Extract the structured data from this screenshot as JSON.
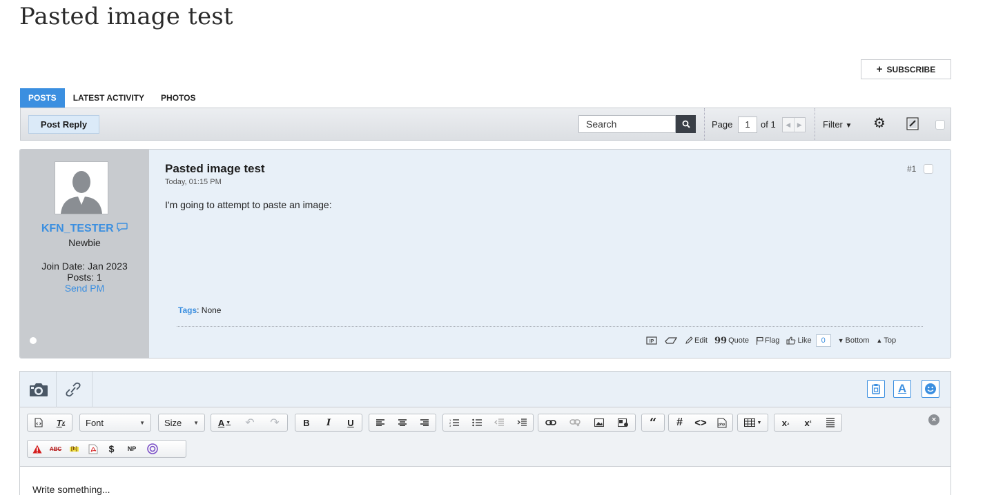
{
  "page": {
    "title": "Pasted image test"
  },
  "subscribe": {
    "label": "SUBSCRIBE"
  },
  "tabs": [
    {
      "label": "POSTS",
      "active": true
    },
    {
      "label": "LATEST ACTIVITY",
      "active": false
    },
    {
      "label": "PHOTOS",
      "active": false
    }
  ],
  "toolbar": {
    "post_reply": "Post Reply",
    "search_placeholder": "Search",
    "page_label": "Page",
    "page_value": "1",
    "of_label": "of 1",
    "filter_label": "Filter"
  },
  "post": {
    "author": {
      "username": "KFN_TESTER",
      "title": "Newbie",
      "join_date": "Join Date: Jan 2023",
      "posts": "Posts: 1",
      "send_pm": "Send PM"
    },
    "title": "Pasted image test",
    "date": "Today, 01:15 PM",
    "number": "#1",
    "body": "I'm going to attempt to paste an image:",
    "tags_label": "Tags",
    "tags_value": ": None",
    "actions": {
      "edit": "Edit",
      "quote": "Quote",
      "flag": "Flag",
      "like": "Like",
      "like_count": "0",
      "bottom": "Bottom",
      "top": "Top"
    }
  },
  "editor": {
    "font_label": "Font",
    "size_label": "Size",
    "placeholder": "Write something...",
    "np_label": "NP"
  },
  "colors": {
    "accent": "#3b8fe0",
    "post_bg": "#e8f0f8",
    "userinfo_bg": "#c8cbcf"
  }
}
